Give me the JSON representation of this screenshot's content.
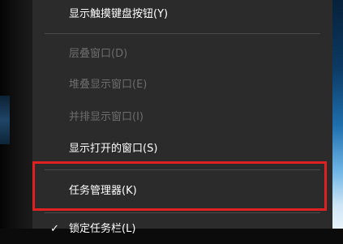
{
  "menu": {
    "items": [
      {
        "label": "显示触摸键盘按钮(Y)",
        "enabled": true
      },
      {
        "label": "层叠窗口(D)",
        "enabled": false
      },
      {
        "label": "堆叠显示窗口(E)",
        "enabled": false
      },
      {
        "label": "并排显示窗口(I)",
        "enabled": false
      },
      {
        "label": "显示打开的窗口(S)",
        "enabled": true
      },
      {
        "label": "任务管理器(K)",
        "enabled": true,
        "highlighted": true
      },
      {
        "label": "锁定任务栏(L)",
        "enabled": true,
        "checked": true
      }
    ],
    "check_glyph": "✓"
  },
  "colors": {
    "menu_bg": "#2b2b2b",
    "text": "#ffffff",
    "disabled_text": "#6d6d6d",
    "separator": "#4a4a4a",
    "highlight_border": "#e02121"
  }
}
